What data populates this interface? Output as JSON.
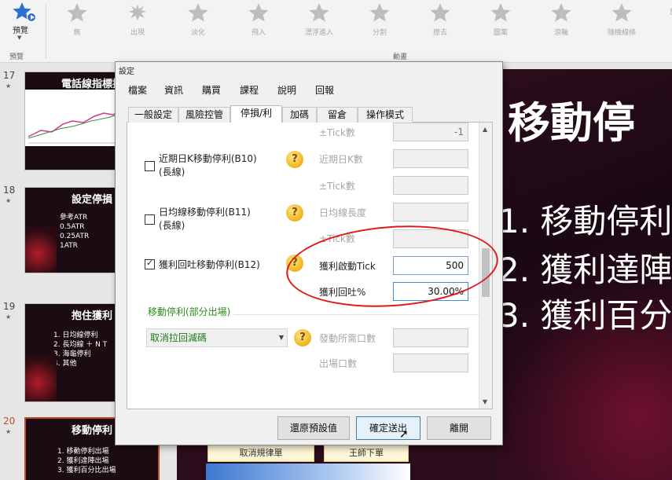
{
  "ribbon": {
    "preview_label": "預覽",
    "preview_group": "預覽",
    "animation_group": "動畫",
    "animations": [
      {
        "label": "無",
        "icon": "star-icon"
      },
      {
        "label": "出現",
        "icon": "star-burst-icon"
      },
      {
        "label": "淡化",
        "icon": "star-icon"
      },
      {
        "label": "飛入",
        "icon": "star-icon"
      },
      {
        "label": "漂浮進入",
        "icon": "star-icon"
      },
      {
        "label": "分割",
        "icon": "star-icon"
      },
      {
        "label": "擦去",
        "icon": "star-icon"
      },
      {
        "label": "圖案",
        "icon": "star-icon"
      },
      {
        "label": "滾輪",
        "icon": "star-icon"
      },
      {
        "label": "隨機線條",
        "icon": "star-icon"
      }
    ],
    "overflow_label": "放"
  },
  "thumbnails": [
    {
      "number": "17",
      "title": "電話線指標提",
      "lines": []
    },
    {
      "number": "18",
      "title": "設定停損",
      "lines": [
        "參考ATR",
        "0.5ATR",
        "0.25ATR",
        "1ATR"
      ]
    },
    {
      "number": "19",
      "title": "抱住獲利",
      "lines": [
        "1. 日均線停利",
        "2. 長均線 ＋ N T",
        "3. 海龜停利",
        "4. 其他"
      ]
    },
    {
      "number": "20",
      "title": "移動停利",
      "lines": [
        "1. 移動停利出場",
        "2. 獲利達陣出場",
        "3. 獲利百分比出場"
      ]
    }
  ],
  "slide": {
    "title": "移動停",
    "lines": [
      "1. 移動停利",
      "2. 獲利達陣",
      "3. 獲利百分"
    ],
    "button_a": "取消規律單",
    "button_b": "王師下單"
  },
  "dialog": {
    "title": "設定",
    "menu": [
      "檔案",
      "資訊",
      "購買",
      "課程",
      "說明",
      "回報"
    ],
    "tabs": [
      "一般設定",
      "風險控管",
      "停損/利",
      "加碼",
      "留倉",
      "操作模式"
    ],
    "active_tab": "停損/利",
    "rows": {
      "tick_top_label": "±Tick數",
      "tick_top_value": "-1",
      "b10_label": "近期日K移動停利(B10)",
      "b10_sub": "(長線)",
      "b10_field1_label": "近期日K數",
      "b10_field2_label": "±Tick數",
      "b11_label": "日均線移動停利(B11)",
      "b11_sub": "(長線)",
      "b11_field1_label": "日均線長度",
      "b11_field2_label": "±Tick數",
      "b12_label": "獲利回吐移動停利(B12)",
      "b12_field1_label": "獲利啟動Tick",
      "b12_field1_value": "500",
      "b12_field2_label": "獲利回吐%",
      "b12_field2_value": "30.00%"
    },
    "section": {
      "title": "移動停利(部分出場)",
      "dropdown_value": "取消拉回減碼",
      "field1_label": "發動所需口數",
      "field2_label": "出場口數"
    },
    "buttons": {
      "restore": "還原預設值",
      "confirm": "確定送出",
      "close": "離開"
    }
  }
}
